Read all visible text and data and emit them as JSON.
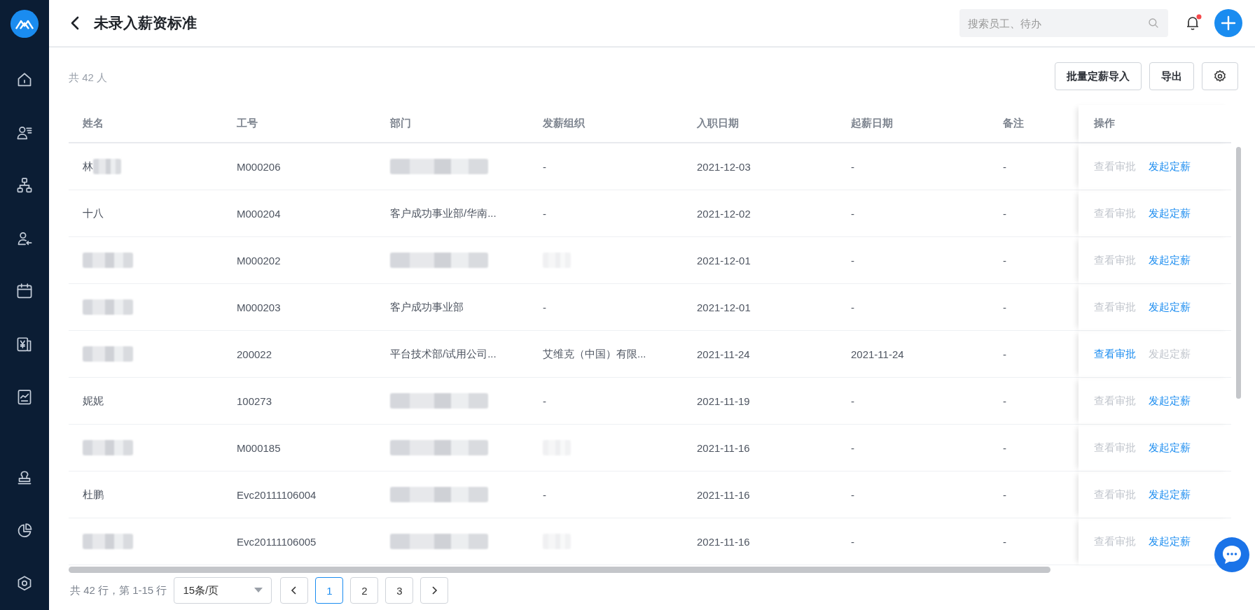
{
  "header": {
    "title": "未录入薪资标准",
    "search": {
      "placeholder": "搜索员工、待办"
    },
    "notification": {
      "unread": true
    }
  },
  "summary": "共 42 人",
  "toolbar": {
    "buttons": [
      "批量定薪导入",
      "导出"
    ]
  },
  "table": {
    "columns": [
      "姓名",
      "工号",
      "部门",
      "发薪组织",
      "入职日期",
      "起薪日期",
      "备注",
      "操作"
    ],
    "rows": [
      {
        "cells": [
          {
            "kind": "partly_blurred",
            "text": "林"
          },
          {
            "kind": "text",
            "text": "M000206"
          },
          {
            "kind": "blurred"
          },
          {
            "kind": "text",
            "text": "-"
          },
          {
            "kind": "text",
            "text": "2021-12-03"
          },
          {
            "kind": "text",
            "text": "-"
          },
          {
            "kind": "text",
            "text": "-"
          }
        ],
        "actions": [
          {
            "label": "查看审批",
            "disabled": true
          },
          {
            "label": "发起定薪",
            "disabled": false
          }
        ]
      },
      {
        "cells": [
          {
            "kind": "text",
            "text": "十八"
          },
          {
            "kind": "text",
            "text": "M000204"
          },
          {
            "kind": "text",
            "text": "客户成功事业部/华南..."
          },
          {
            "kind": "text",
            "text": "-"
          },
          {
            "kind": "text",
            "text": "2021-12-02"
          },
          {
            "kind": "text",
            "text": "-"
          },
          {
            "kind": "text",
            "text": "-"
          }
        ],
        "actions": [
          {
            "label": "查看审批",
            "disabled": true
          },
          {
            "label": "发起定薪",
            "disabled": false
          }
        ]
      },
      {
        "cells": [
          {
            "kind": "blurred"
          },
          {
            "kind": "text",
            "text": "M000202"
          },
          {
            "kind": "blurred"
          },
          {
            "kind": "blurred"
          },
          {
            "kind": "text",
            "text": "2021-12-01"
          },
          {
            "kind": "text",
            "text": "-"
          },
          {
            "kind": "text",
            "text": "-"
          }
        ],
        "actions": [
          {
            "label": "查看审批",
            "disabled": true
          },
          {
            "label": "发起定薪",
            "disabled": false
          }
        ]
      },
      {
        "cells": [
          {
            "kind": "blurred"
          },
          {
            "kind": "text",
            "text": "M000203"
          },
          {
            "kind": "text",
            "text": "客户成功事业部"
          },
          {
            "kind": "text",
            "text": "-"
          },
          {
            "kind": "text",
            "text": "2021-12-01"
          },
          {
            "kind": "text",
            "text": "-"
          },
          {
            "kind": "text",
            "text": "-"
          }
        ],
        "actions": [
          {
            "label": "查看审批",
            "disabled": true
          },
          {
            "label": "发起定薪",
            "disabled": false
          }
        ]
      },
      {
        "cells": [
          {
            "kind": "blurred"
          },
          {
            "kind": "text",
            "text": "200022"
          },
          {
            "kind": "text",
            "text": "平台技术部/试用公司..."
          },
          {
            "kind": "text",
            "text": "艾维克（中国）有限..."
          },
          {
            "kind": "text",
            "text": "2021-11-24"
          },
          {
            "kind": "text",
            "text": "2021-11-24"
          },
          {
            "kind": "text",
            "text": "-"
          }
        ],
        "actions": [
          {
            "label": "查看审批",
            "disabled": false
          },
          {
            "label": "发起定薪",
            "disabled": true
          }
        ]
      },
      {
        "cells": [
          {
            "kind": "text",
            "text": "妮妮"
          },
          {
            "kind": "text",
            "text": "100273"
          },
          {
            "kind": "blurred"
          },
          {
            "kind": "text",
            "text": "-"
          },
          {
            "kind": "text",
            "text": "2021-11-19"
          },
          {
            "kind": "text",
            "text": "-"
          },
          {
            "kind": "text",
            "text": "-"
          }
        ],
        "actions": [
          {
            "label": "查看审批",
            "disabled": true
          },
          {
            "label": "发起定薪",
            "disabled": false
          }
        ]
      },
      {
        "cells": [
          {
            "kind": "blurred"
          },
          {
            "kind": "text",
            "text": "M000185"
          },
          {
            "kind": "blurred"
          },
          {
            "kind": "blurred"
          },
          {
            "kind": "text",
            "text": "2021-11-16"
          },
          {
            "kind": "text",
            "text": "-"
          },
          {
            "kind": "text",
            "text": "-"
          }
        ],
        "actions": [
          {
            "label": "查看审批",
            "disabled": true
          },
          {
            "label": "发起定薪",
            "disabled": false
          }
        ]
      },
      {
        "cells": [
          {
            "kind": "text",
            "text": "杜鹏"
          },
          {
            "kind": "text",
            "text": "Evc20111106004"
          },
          {
            "kind": "blurred"
          },
          {
            "kind": "text",
            "text": "-"
          },
          {
            "kind": "text",
            "text": "2021-11-16"
          },
          {
            "kind": "text",
            "text": "-"
          },
          {
            "kind": "text",
            "text": "-"
          }
        ],
        "actions": [
          {
            "label": "查看审批",
            "disabled": true
          },
          {
            "label": "发起定薪",
            "disabled": false
          }
        ]
      },
      {
        "cells": [
          {
            "kind": "blurred"
          },
          {
            "kind": "text",
            "text": "Evc20111106005"
          },
          {
            "kind": "blurred"
          },
          {
            "kind": "blurred"
          },
          {
            "kind": "text",
            "text": "2021-11-16"
          },
          {
            "kind": "text",
            "text": "-"
          },
          {
            "kind": "text",
            "text": "-"
          }
        ],
        "actions": [
          {
            "label": "查看审批",
            "disabled": true
          },
          {
            "label": "发起定薪",
            "disabled": false
          }
        ]
      }
    ]
  },
  "pagination": {
    "summary": "共 42 行，第 1-15 行",
    "page_size": "15条/页",
    "pages": [
      {
        "label": "1",
        "selected": true
      },
      {
        "label": "2",
        "selected": false
      },
      {
        "label": "3",
        "selected": false
      }
    ]
  }
}
